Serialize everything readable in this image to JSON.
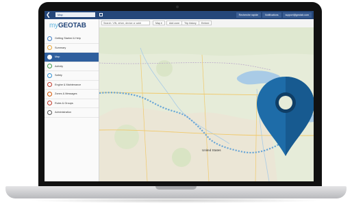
{
  "topbar": {
    "back_icon": "chevron-left-icon",
    "menu_label": "Map",
    "links": [
      "Recherche rapide",
      "Notifications",
      "support@geotab.com"
    ]
  },
  "sidebar": {
    "logo_my": "my",
    "logo_geotab": "GEOTAB",
    "items": [
      {
        "label": "Getting Started & Help",
        "icon": "help-icon",
        "color": "#3e7cc4",
        "active": false
      },
      {
        "label": "Summary",
        "icon": "summary-icon",
        "color": "#e8a435",
        "active": false
      },
      {
        "label": "Map",
        "icon": "map-icon",
        "color": "#ffffff",
        "active": true
      },
      {
        "label": "Activity",
        "icon": "activity-icon",
        "color": "#3b9a4a",
        "active": false
      },
      {
        "label": "Safety",
        "icon": "safety-icon",
        "color": "#2f8fd3",
        "active": false
      },
      {
        "label": "Engine & Maintenance",
        "icon": "wrench-icon",
        "color": "#c0392b",
        "active": false
      },
      {
        "label": "Zones & Messages",
        "icon": "zones-icon",
        "color": "#d35400",
        "active": false
      },
      {
        "label": "Rules & Groups",
        "icon": "rules-icon",
        "color": "#c0392b",
        "active": false
      },
      {
        "label": "Administration",
        "icon": "admin-icon",
        "color": "#555555",
        "active": false
      }
    ]
  },
  "toolbar": {
    "search_placeholder": "Search: VIN, driver, device or addr",
    "buttons": [
      "Map ▾",
      "Add zone",
      "Trip history",
      "Embed"
    ]
  },
  "map": {
    "labels": {
      "country": "United States"
    },
    "colors": {
      "route": "#6aa6d6",
      "pin": "#1e6ca8",
      "pin_light": "#2c86c7"
    }
  }
}
